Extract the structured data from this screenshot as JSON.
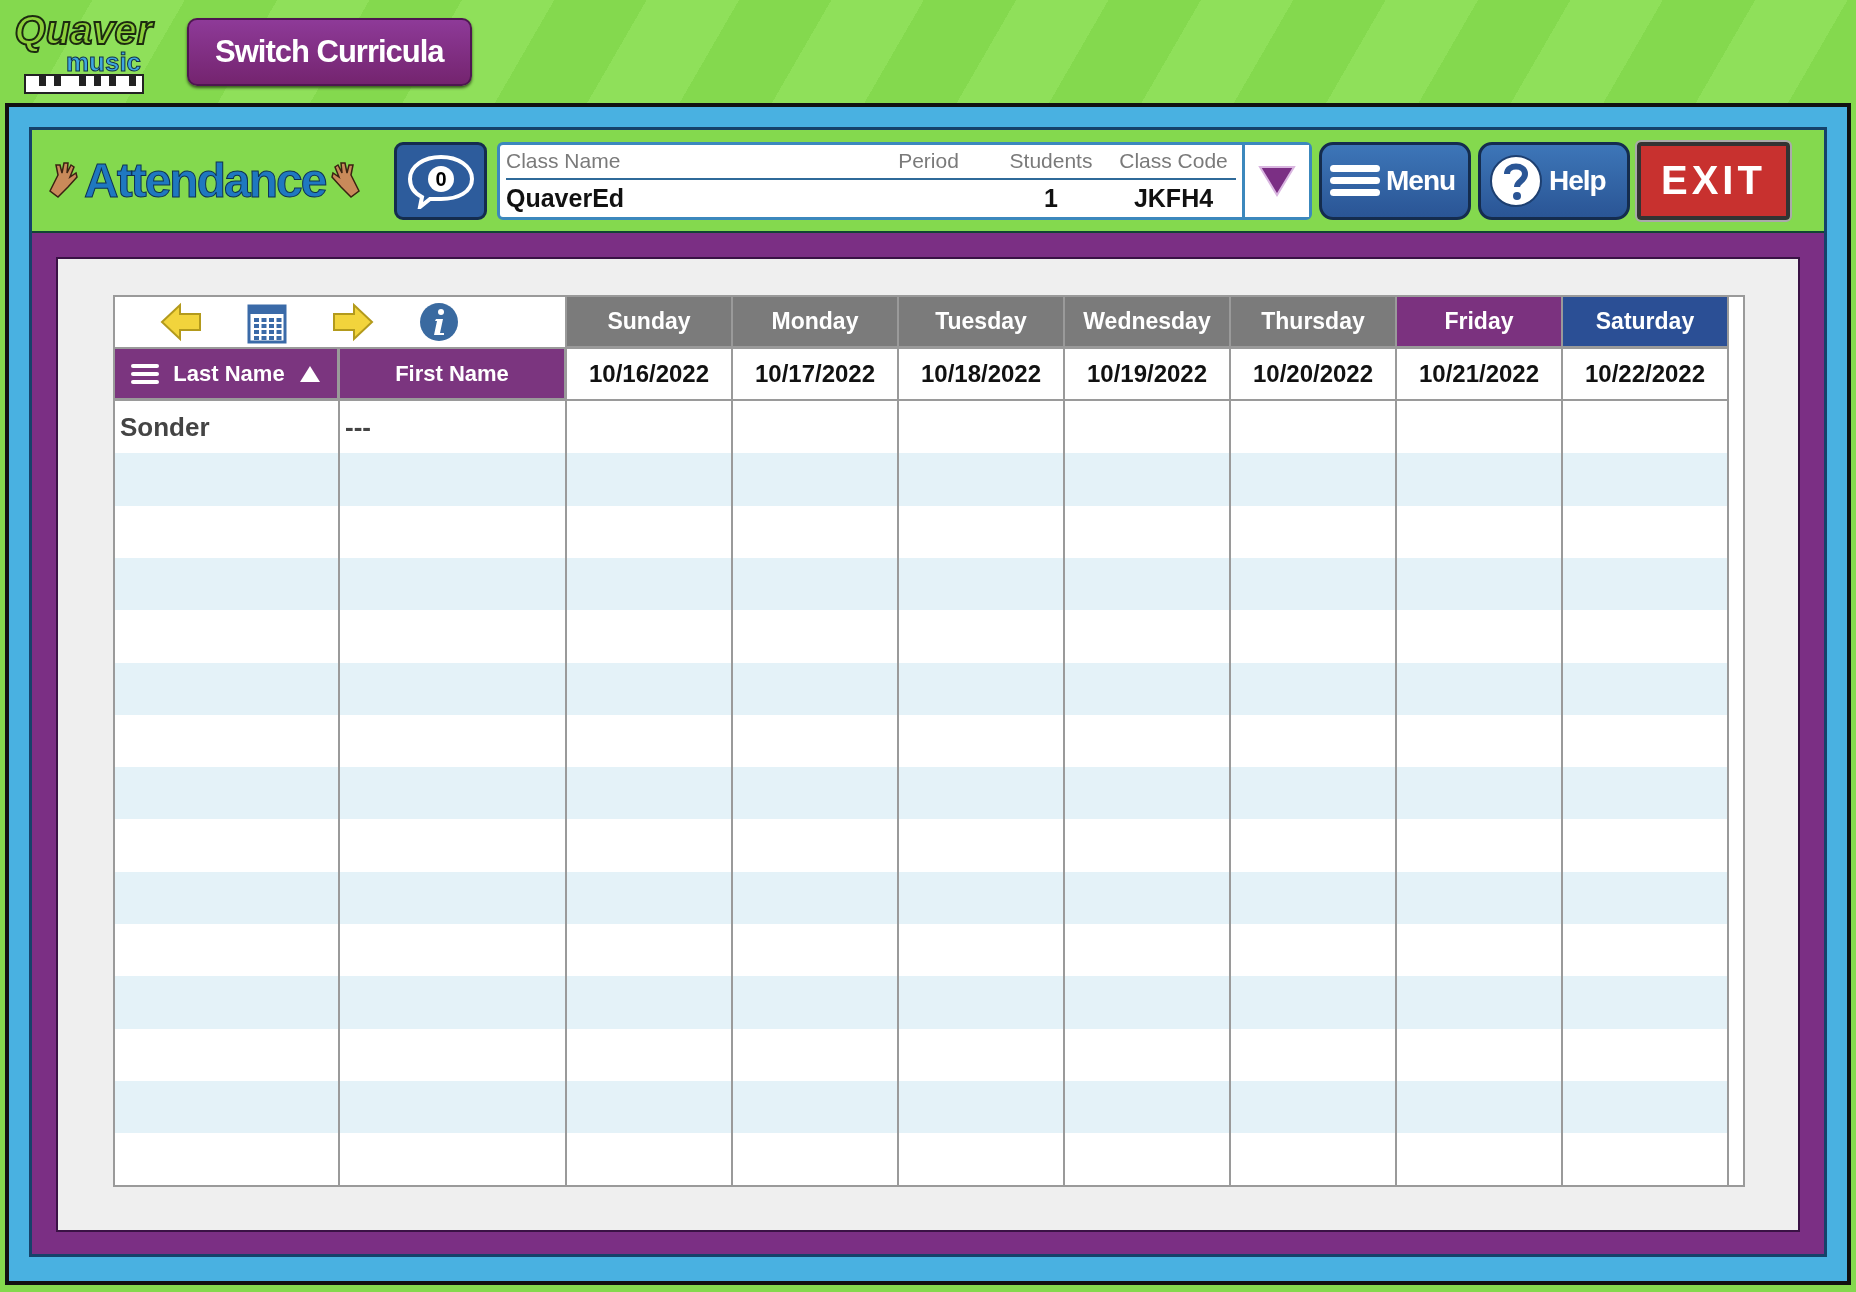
{
  "top_bar": {
    "logo": {
      "line_1": "Quaver",
      "line_2": "music"
    },
    "switch_button": "Switch Curricula"
  },
  "header": {
    "title": "Attendance",
    "messages_count": "0",
    "class_selector": {
      "columns": [
        {
          "label": "Class Name",
          "value": "QuaverEd"
        },
        {
          "label": "Period"
        },
        {
          "label": "Students",
          "value": "1"
        },
        {
          "label": "Class Code",
          "value": "JKFH4"
        }
      ]
    },
    "buttons": [
      {
        "kind": "menu",
        "label": "Menu"
      },
      {
        "kind": "help",
        "label": "Help"
      },
      {
        "kind": "exit",
        "label": "EXIT"
      }
    ]
  },
  "table": {
    "name_columns": [
      {
        "label": "Last Name",
        "sorted": true
      },
      {
        "label": "First Name",
        "sorted": false
      }
    ],
    "days": [
      {
        "day": "Sunday",
        "date": "10/16/2022",
        "color": "#7b7b7b"
      },
      {
        "day": "Monday",
        "date": "10/17/2022",
        "color": "#7b7b7b"
      },
      {
        "day": "Tuesday",
        "date": "10/18/2022",
        "color": "#7b7b7b"
      },
      {
        "day": "Wednesday",
        "date": "10/19/2022",
        "color": "#7b7b7b"
      },
      {
        "day": "Thursday",
        "date": "10/20/2022",
        "color": "#7b7b7b"
      },
      {
        "day": "Friday",
        "date": "10/21/2022",
        "color": "#7b327f"
      },
      {
        "day": "Saturday",
        "date": "10/22/2022",
        "color": "#2b4f95"
      }
    ],
    "rows": [
      {
        "last_name": "Sonder",
        "first_name": "---"
      }
    ]
  }
}
